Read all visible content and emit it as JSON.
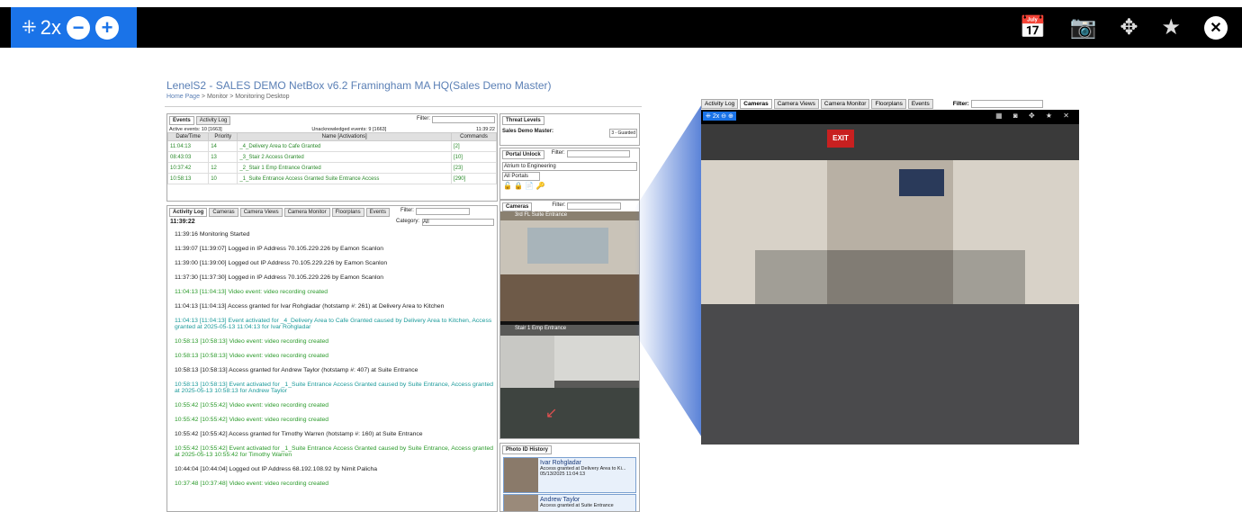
{
  "toolbar": {
    "zoom_label": "2x",
    "icons": [
      "collapse-icon",
      "zoom-out-icon",
      "zoom-in-icon",
      "calendar-icon",
      "camera-icon",
      "move-icon",
      "star-icon",
      "close-icon"
    ]
  },
  "screen": {
    "title": "LenelS2 - SALES DEMO NetBox v6.2 Framingham MA HQ(Sales Demo Master)",
    "breadcrumb_home": "Home Page",
    "breadcrumb_rest": " > Monitor > Monitoring Desktop",
    "events_panel": {
      "tabs": [
        "Events",
        "Activity Log"
      ],
      "filter_label": "Filter:",
      "active_events": "Active events: 10 [1663]",
      "unack_events": "Unacknowledged events: 9 [1663]",
      "time": "11:39:22",
      "columns": [
        "Date/Time",
        "Priority",
        "Name [Activations]",
        "Commands"
      ],
      "rows": [
        {
          "time": "11:04:13",
          "priority": "14",
          "name": "_4_Delivery Area to Cafe Granted",
          "count": "[2]"
        },
        {
          "time": "08:43:03",
          "priority": "13",
          "name": "_3_Stair 2 Access Granted",
          "count": "[10]"
        },
        {
          "time": "10:37:42",
          "priority": "12",
          "name": "_2_Stair 1 Emp Entrance Granted",
          "count": "[23]"
        },
        {
          "time": "10:58:13",
          "priority": "10",
          "name": "_1_Suite Entrance Access Granted Suite Entrance Access",
          "count": "[290]"
        }
      ]
    },
    "threat": {
      "tab": "Threat Levels",
      "label": "Sales Demo Master:",
      "level": "3 - Guarded"
    },
    "portal": {
      "tab": "Portal Unlock",
      "filter_label": "Filter:",
      "selected": "Atrium to Engineering",
      "portals": "All Portals"
    },
    "cams_panel": {
      "tab": "Cameras",
      "filter_label": "Filter:",
      "cam1": "3rd FL Suite Entrance",
      "cam2": "Stair 1 Emp Entrance"
    },
    "activity": {
      "tabs": [
        "Activity Log",
        "Cameras",
        "Camera Views",
        "Camera Monitor",
        "Floorplans",
        "Events"
      ],
      "filter_label": "Filter:",
      "time": "11:39:22",
      "category_label": "Category:",
      "category": "All",
      "lines": [
        {
          "text": "11:39:16 Monitoring Started",
          "c": ""
        },
        {
          "text": "11:39:07 [11:39:07] Logged in IP Address 70.105.229.226 by Eamon Scanlon",
          "c": ""
        },
        {
          "text": "11:39:00 [11:39:00] Logged out IP Address 70.105.229.226 by Eamon Scanlon",
          "c": ""
        },
        {
          "text": "11:37:30 [11:37:30] Logged in IP Address 70.105.229.226 by Eamon Scanlon",
          "c": ""
        },
        {
          "text": "11:04:13 [11:04:13] Video event: video recording created",
          "c": "g"
        },
        {
          "text": "11:04:13 [11:04:13] Access granted for Ivar Rohgladar (hotstamp #: 261) at Delivery Area to Kitchen",
          "c": ""
        },
        {
          "text": "11:04:13 [11:04:13] Event activated for _4_Delivery Area to Cafe Granted caused by Delivery Area to Kitchen, Access granted at 2025-05-13 11:04:13 for Ivar Rohgladar",
          "c": "t"
        },
        {
          "text": "10:58:13 [10:58:13] Video event: video recording created",
          "c": "g"
        },
        {
          "text": "10:58:13 [10:58:13] Video event: video recording created",
          "c": "g"
        },
        {
          "text": "10:58:13 [10:58:13] Access granted for Andrew Taylor (hotstamp #: 407) at Suite Entrance",
          "c": ""
        },
        {
          "text": "10:58:13 [10:58:13] Event activated for _1_Suite Entrance Access Granted caused by Suite Entrance, Access granted at 2025-05-13 10:58:13 for Andrew Taylor",
          "c": "t"
        },
        {
          "text": "10:55:42 [10:55:42] Video event: video recording created",
          "c": "g"
        },
        {
          "text": "10:55:42 [10:55:42] Video event: video recording created",
          "c": "g"
        },
        {
          "text": "10:55:42 [10:55:42] Access granted for Timothy Warren (hotstamp #: 160) at Suite Entrance",
          "c": ""
        },
        {
          "text": "10:55:42 [10:55:42] Event activated for _1_Suite Entrance Access Granted caused by Suite Entrance, Access granted at 2025-05-13 10:55:42 for Timothy Warren",
          "c": "g"
        },
        {
          "text": "10:44:04 [10:44:04] Logged out IP Address 68.192.108.92 by Nimit Palicha",
          "c": ""
        },
        {
          "text": "10:37:48 [10:37:48] Video event: video recording created",
          "c": "g"
        }
      ]
    },
    "photo_id": {
      "tab": "Photo ID History",
      "entries": [
        {
          "name": "Ivar Rohgladar",
          "detail": "Access granted at Delivery Area to Ki...",
          "date": "05/13/2025 11:04:13"
        },
        {
          "name": "Andrew Taylor",
          "detail": "Access granted at Suite Entrance",
          "date": ""
        }
      ]
    }
  },
  "bigcam": {
    "tabs": [
      "Activity Log",
      "Cameras",
      "Camera Views",
      "Camera Monitor",
      "Floorplans",
      "Events"
    ],
    "filter_label": "Filter:",
    "zoom_label": "2x",
    "exit_sign": "EXIT"
  }
}
